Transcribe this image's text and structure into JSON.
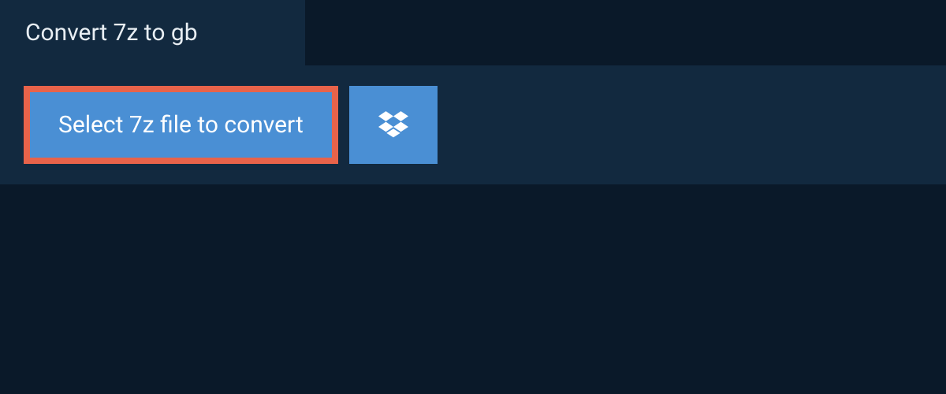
{
  "tab": {
    "title": "Convert 7z to gb"
  },
  "actions": {
    "select_label": "Select 7z file to convert"
  },
  "colors": {
    "background": "#0a1929",
    "panel": "#12293f",
    "button": "#4a8fd4",
    "highlight_border": "#e8634a",
    "text_light": "#ffffff",
    "text_tab": "#e8eef3"
  }
}
